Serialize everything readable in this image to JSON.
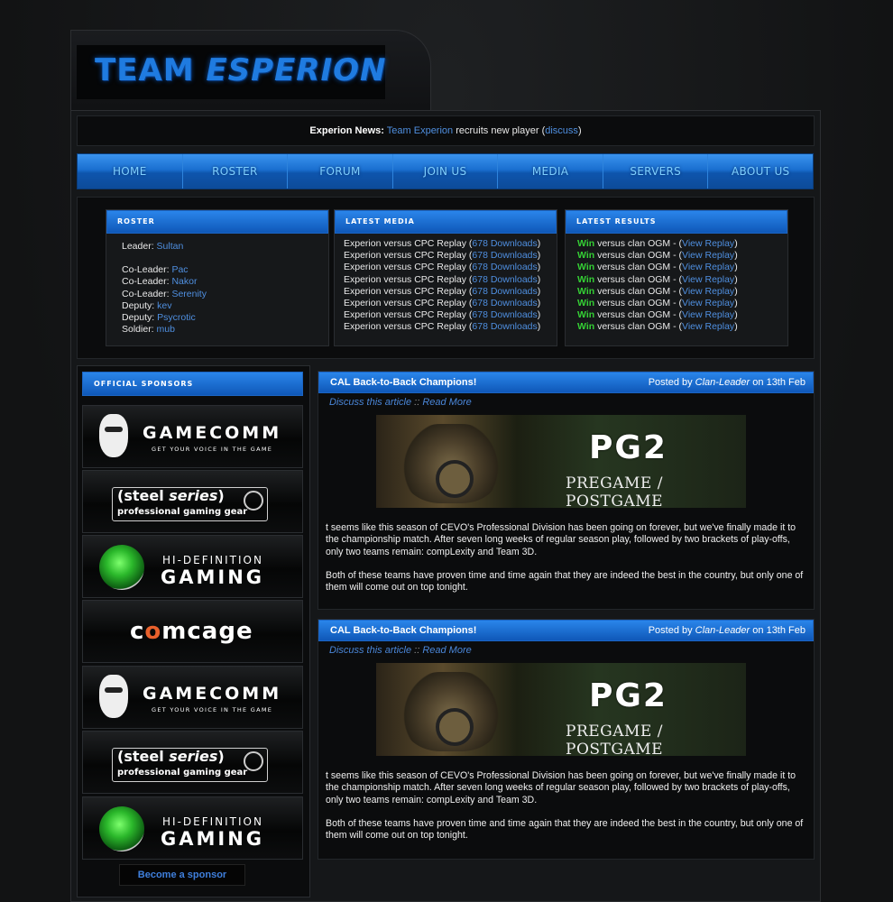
{
  "header": {
    "logo_part1": "TEAM ",
    "logo_part2": "ESPERION"
  },
  "news": {
    "label": "Experion News:",
    "team": "Team Experion",
    "text": " recruits new player (",
    "discuss": "discuss",
    "close": ")"
  },
  "nav": [
    "HOME",
    "ROSTER",
    "FORUM",
    "JOIN US",
    "MEDIA",
    "SERVERS",
    "ABOUT US"
  ],
  "roster": {
    "title": "Roster",
    "leader": {
      "role": "Leader:",
      "name": "Sultan"
    },
    "members": [
      {
        "role": "Co-Leader:",
        "name": "Pac"
      },
      {
        "role": "Co-Leader:",
        "name": "Nakor"
      },
      {
        "role": "Co-Leader:",
        "name": "Serenity"
      },
      {
        "role": "Deputy:",
        "name": "kev"
      },
      {
        "role": "Deputy:",
        "name": "Psycrotic"
      },
      {
        "role": "Soldier:",
        "name": "mub"
      }
    ]
  },
  "media": {
    "title": "Latest Media",
    "item_text": "Experion versus CPC Replay (",
    "item_link": "678 Downloads",
    "item_close": ")",
    "count": 8
  },
  "results": {
    "title": "Latest Results",
    "win": "Win",
    "text": " versus clan OGM - (",
    "link": "View Replay",
    "close": ")"
  },
  "sponsors": {
    "title": "Official Sponsors",
    "gamecomm": {
      "name": "GAMECOMM",
      "tagline": "GET YOUR VOICE IN THE GAME"
    },
    "steelseries": {
      "name_a": "(steel ",
      "name_b": "series",
      "name_c": ")",
      "tagline": "professional gaming gear"
    },
    "hidef": {
      "top": "HI-DEFINITION",
      "bottom": "GAMING"
    },
    "comcage": {
      "a": "c",
      "b": "o",
      "c": "mcage"
    },
    "become": "Become a sponsor"
  },
  "articles": [
    {
      "title": "CAL Back-to-Back Champions!",
      "posted_by": "Posted by",
      "author": "Clan-Leader",
      "date": "on 13th Feb",
      "discuss": "Discuss this article",
      "sep": "::",
      "read_more": "Read More",
      "banner_title": "PG2",
      "banner_sub": "PREGAME / POSTGAME",
      "p1": "t seems like this season of CEVO's Professional Division has been going on forever, but we've finally made it to the championship match. After seven long weeks of regular season play, followed by two brackets of play-offs, only two teams remain: compLexity and Team 3D.",
      "p2": "Both of these teams have proven time and time again that they are indeed the best in the country, but only one of them will come out on top tonight."
    },
    {
      "title": "CAL Back-to-Back Champions!",
      "posted_by": "Posted by",
      "author": "Clan-Leader",
      "date": "on 13th Feb",
      "discuss": "Discuss this article",
      "sep": "::",
      "read_more": "Read More",
      "banner_title": "PG2",
      "banner_sub": "PREGAME / POSTGAME",
      "p1": "t seems like this season of CEVO's Professional Division has been going on forever, but we've finally made it to the championship match. After seven long weeks of regular season play, followed by two brackets of play-offs, only two teams remain: compLexity and Team 3D.",
      "p2": "Both of these teams have proven time and time again that they are indeed the best in the country, but only one of them will come out on top tonight."
    }
  ],
  "colors": {
    "accent": "#1f7be0",
    "link": "#4f8fe0",
    "win": "#35d035",
    "bg": "#121314"
  }
}
